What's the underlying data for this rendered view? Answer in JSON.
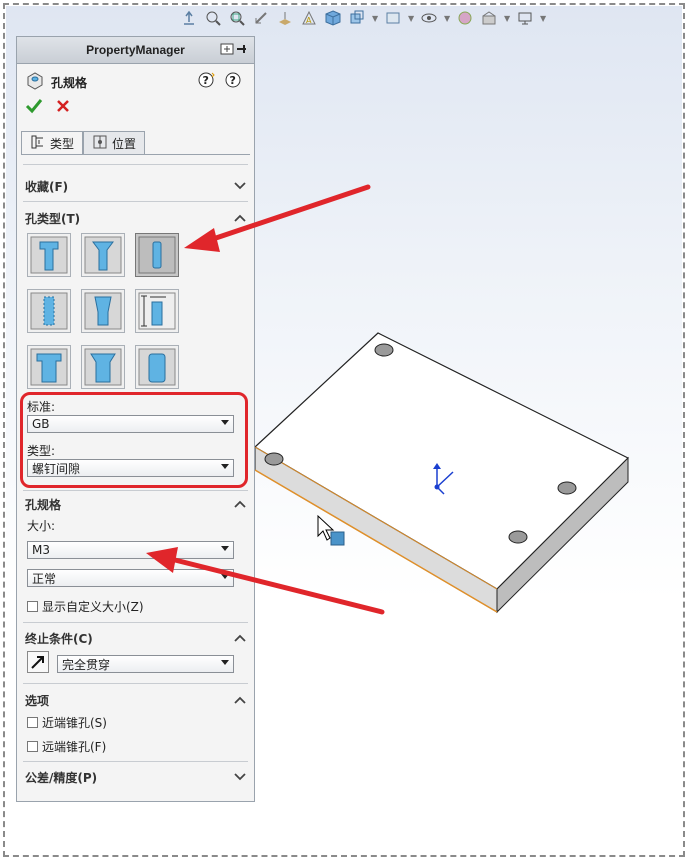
{
  "panel": {
    "header": "PropertyManager",
    "feature_title": "孔规格",
    "tabs": [
      {
        "label": "类型",
        "active": true
      },
      {
        "label": "位置",
        "active": false
      }
    ]
  },
  "sections": {
    "favorites": {
      "label": "收藏(F)",
      "state": "collapsed"
    },
    "hole_type": {
      "label": "孔类型(T)",
      "state": "expanded",
      "buttons": [
        {
          "name": "counterbore",
          "selected": false
        },
        {
          "name": "countersink",
          "selected": false
        },
        {
          "name": "hole",
          "selected": true
        },
        {
          "name": "straight-tap",
          "selected": false
        },
        {
          "name": "tapered-tap",
          "selected": false
        },
        {
          "name": "legacy",
          "selected": false
        },
        {
          "name": "counterbore-slot",
          "selected": false
        },
        {
          "name": "countersink-slot",
          "selected": false
        },
        {
          "name": "slot",
          "selected": false
        }
      ],
      "standard_label": "标准:",
      "standard_value": "GB",
      "type_label": "类型:",
      "type_value": "螺钉间隙"
    },
    "hole_spec": {
      "label": "孔规格",
      "state": "expanded",
      "size_label": "大小:",
      "size_value": "M3",
      "fit_value": "正常",
      "custom_size_label": "显示自定义大小(Z)",
      "custom_size_checked": false
    },
    "end_condition": {
      "label": "终止条件(C)",
      "state": "expanded",
      "value": "完全贯穿"
    },
    "options": {
      "label": "选项",
      "state": "expanded",
      "near_side": {
        "label": "近端锥孔(S)",
        "checked": false
      },
      "far_side": {
        "label": "远端锥孔(F)",
        "checked": false
      }
    },
    "tolerance": {
      "label": "公差/精度(P)",
      "state": "collapsed"
    }
  },
  "colors": {
    "accent_red": "#e0262b",
    "hole_blue": "#5fb3e3",
    "ok_green": "#2e9a2e",
    "cancel_red": "#d42020",
    "edge_orange": "#e0902a"
  }
}
